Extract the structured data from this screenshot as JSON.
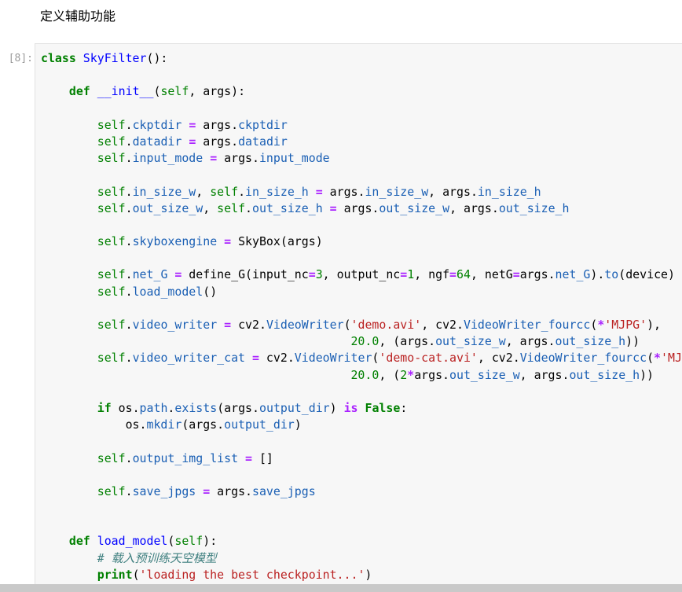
{
  "markdown": {
    "heading": "定义辅助功能"
  },
  "cell": {
    "prompt": "[8]:",
    "lines": [
      [
        {
          "t": "kw",
          "v": "class"
        },
        {
          "t": "",
          "v": " "
        },
        {
          "t": "cls",
          "v": "SkyFilter"
        },
        {
          "t": "",
          "v": "():"
        }
      ],
      [],
      [
        {
          "t": "",
          "v": "    "
        },
        {
          "t": "kw",
          "v": "def"
        },
        {
          "t": "",
          "v": " "
        },
        {
          "t": "fn",
          "v": "__init__"
        },
        {
          "t": "",
          "v": "("
        },
        {
          "t": "slf",
          "v": "self"
        },
        {
          "t": "",
          "v": ", args):"
        }
      ],
      [],
      [
        {
          "t": "",
          "v": "        "
        },
        {
          "t": "slf",
          "v": "self"
        },
        {
          "t": "",
          "v": "."
        },
        {
          "t": "attr",
          "v": "ckptdir"
        },
        {
          "t": "",
          "v": " "
        },
        {
          "t": "op",
          "v": "="
        },
        {
          "t": "",
          "v": " args."
        },
        {
          "t": "attr",
          "v": "ckptdir"
        }
      ],
      [
        {
          "t": "",
          "v": "        "
        },
        {
          "t": "slf",
          "v": "self"
        },
        {
          "t": "",
          "v": "."
        },
        {
          "t": "attr",
          "v": "datadir"
        },
        {
          "t": "",
          "v": " "
        },
        {
          "t": "op",
          "v": "="
        },
        {
          "t": "",
          "v": " args."
        },
        {
          "t": "attr",
          "v": "datadir"
        }
      ],
      [
        {
          "t": "",
          "v": "        "
        },
        {
          "t": "slf",
          "v": "self"
        },
        {
          "t": "",
          "v": "."
        },
        {
          "t": "attr",
          "v": "input_mode"
        },
        {
          "t": "",
          "v": " "
        },
        {
          "t": "op",
          "v": "="
        },
        {
          "t": "",
          "v": " args."
        },
        {
          "t": "attr",
          "v": "input_mode"
        }
      ],
      [],
      [
        {
          "t": "",
          "v": "        "
        },
        {
          "t": "slf",
          "v": "self"
        },
        {
          "t": "",
          "v": "."
        },
        {
          "t": "attr",
          "v": "in_size_w"
        },
        {
          "t": "",
          "v": ", "
        },
        {
          "t": "slf",
          "v": "self"
        },
        {
          "t": "",
          "v": "."
        },
        {
          "t": "attr",
          "v": "in_size_h"
        },
        {
          "t": "",
          "v": " "
        },
        {
          "t": "op",
          "v": "="
        },
        {
          "t": "",
          "v": " args."
        },
        {
          "t": "attr",
          "v": "in_size_w"
        },
        {
          "t": "",
          "v": ", args."
        },
        {
          "t": "attr",
          "v": "in_size_h"
        }
      ],
      [
        {
          "t": "",
          "v": "        "
        },
        {
          "t": "slf",
          "v": "self"
        },
        {
          "t": "",
          "v": "."
        },
        {
          "t": "attr",
          "v": "out_size_w"
        },
        {
          "t": "",
          "v": ", "
        },
        {
          "t": "slf",
          "v": "self"
        },
        {
          "t": "",
          "v": "."
        },
        {
          "t": "attr",
          "v": "out_size_h"
        },
        {
          "t": "",
          "v": " "
        },
        {
          "t": "op",
          "v": "="
        },
        {
          "t": "",
          "v": " args."
        },
        {
          "t": "attr",
          "v": "out_size_w"
        },
        {
          "t": "",
          "v": ", args."
        },
        {
          "t": "attr",
          "v": "out_size_h"
        }
      ],
      [],
      [
        {
          "t": "",
          "v": "        "
        },
        {
          "t": "slf",
          "v": "self"
        },
        {
          "t": "",
          "v": "."
        },
        {
          "t": "attr",
          "v": "skyboxengine"
        },
        {
          "t": "",
          "v": " "
        },
        {
          "t": "op",
          "v": "="
        },
        {
          "t": "",
          "v": " SkyBox(args)"
        }
      ],
      [],
      [
        {
          "t": "",
          "v": "        "
        },
        {
          "t": "slf",
          "v": "self"
        },
        {
          "t": "",
          "v": "."
        },
        {
          "t": "attr",
          "v": "net_G"
        },
        {
          "t": "",
          "v": " "
        },
        {
          "t": "op",
          "v": "="
        },
        {
          "t": "",
          "v": " define_G(input_nc"
        },
        {
          "t": "op",
          "v": "="
        },
        {
          "t": "num",
          "v": "3"
        },
        {
          "t": "",
          "v": ", output_nc"
        },
        {
          "t": "op",
          "v": "="
        },
        {
          "t": "num",
          "v": "1"
        },
        {
          "t": "",
          "v": ", ngf"
        },
        {
          "t": "op",
          "v": "="
        },
        {
          "t": "num",
          "v": "64"
        },
        {
          "t": "",
          "v": ", netG"
        },
        {
          "t": "op",
          "v": "="
        },
        {
          "t": "",
          "v": "args."
        },
        {
          "t": "attr",
          "v": "net_G"
        },
        {
          "t": "",
          "v": ")."
        },
        {
          "t": "attr",
          "v": "to"
        },
        {
          "t": "",
          "v": "(device)"
        }
      ],
      [
        {
          "t": "",
          "v": "        "
        },
        {
          "t": "slf",
          "v": "self"
        },
        {
          "t": "",
          "v": "."
        },
        {
          "t": "attr",
          "v": "load_model"
        },
        {
          "t": "",
          "v": "()"
        }
      ],
      [],
      [
        {
          "t": "",
          "v": "        "
        },
        {
          "t": "slf",
          "v": "self"
        },
        {
          "t": "",
          "v": "."
        },
        {
          "t": "attr",
          "v": "video_writer"
        },
        {
          "t": "",
          "v": " "
        },
        {
          "t": "op",
          "v": "="
        },
        {
          "t": "",
          "v": " cv2."
        },
        {
          "t": "attr",
          "v": "VideoWriter"
        },
        {
          "t": "",
          "v": "("
        },
        {
          "t": "str",
          "v": "'demo.avi'"
        },
        {
          "t": "",
          "v": ", cv2."
        },
        {
          "t": "attr",
          "v": "VideoWriter_fourcc"
        },
        {
          "t": "",
          "v": "("
        },
        {
          "t": "op",
          "v": "*"
        },
        {
          "t": "str",
          "v": "'MJPG'"
        },
        {
          "t": "",
          "v": "),"
        }
      ],
      [
        {
          "t": "",
          "v": "                                            "
        },
        {
          "t": "num",
          "v": "20.0"
        },
        {
          "t": "",
          "v": ", (args."
        },
        {
          "t": "attr",
          "v": "out_size_w"
        },
        {
          "t": "",
          "v": ", args."
        },
        {
          "t": "attr",
          "v": "out_size_h"
        },
        {
          "t": "",
          "v": "))"
        }
      ],
      [
        {
          "t": "",
          "v": "        "
        },
        {
          "t": "slf",
          "v": "self"
        },
        {
          "t": "",
          "v": "."
        },
        {
          "t": "attr",
          "v": "video_writer_cat"
        },
        {
          "t": "",
          "v": " "
        },
        {
          "t": "op",
          "v": "="
        },
        {
          "t": "",
          "v": " cv2."
        },
        {
          "t": "attr",
          "v": "VideoWriter"
        },
        {
          "t": "",
          "v": "("
        },
        {
          "t": "str",
          "v": "'demo-cat.avi'"
        },
        {
          "t": "",
          "v": ", cv2."
        },
        {
          "t": "attr",
          "v": "VideoWriter_fourcc"
        },
        {
          "t": "",
          "v": "("
        },
        {
          "t": "op",
          "v": "*"
        },
        {
          "t": "str",
          "v": "'MJ"
        }
      ],
      [
        {
          "t": "",
          "v": "                                            "
        },
        {
          "t": "num",
          "v": "20.0"
        },
        {
          "t": "",
          "v": ", ("
        },
        {
          "t": "num",
          "v": "2"
        },
        {
          "t": "op",
          "v": "*"
        },
        {
          "t": "",
          "v": "args."
        },
        {
          "t": "attr",
          "v": "out_size_w"
        },
        {
          "t": "",
          "v": ", args."
        },
        {
          "t": "attr",
          "v": "out_size_h"
        },
        {
          "t": "",
          "v": "))"
        }
      ],
      [],
      [
        {
          "t": "",
          "v": "        "
        },
        {
          "t": "kw",
          "v": "if"
        },
        {
          "t": "",
          "v": " os."
        },
        {
          "t": "attr",
          "v": "path"
        },
        {
          "t": "",
          "v": "."
        },
        {
          "t": "attr",
          "v": "exists"
        },
        {
          "t": "",
          "v": "(args."
        },
        {
          "t": "attr",
          "v": "output_dir"
        },
        {
          "t": "",
          "v": ") "
        },
        {
          "t": "ow",
          "v": "is"
        },
        {
          "t": "",
          "v": " "
        },
        {
          "t": "kw",
          "v": "False"
        },
        {
          "t": "",
          "v": ":"
        }
      ],
      [
        {
          "t": "",
          "v": "            os."
        },
        {
          "t": "attr",
          "v": "mkdir"
        },
        {
          "t": "",
          "v": "(args."
        },
        {
          "t": "attr",
          "v": "output_dir"
        },
        {
          "t": "",
          "v": ")"
        }
      ],
      [],
      [
        {
          "t": "",
          "v": "        "
        },
        {
          "t": "slf",
          "v": "self"
        },
        {
          "t": "",
          "v": "."
        },
        {
          "t": "attr",
          "v": "output_img_list"
        },
        {
          "t": "",
          "v": " "
        },
        {
          "t": "op",
          "v": "="
        },
        {
          "t": "",
          "v": " []"
        }
      ],
      [],
      [
        {
          "t": "",
          "v": "        "
        },
        {
          "t": "slf",
          "v": "self"
        },
        {
          "t": "",
          "v": "."
        },
        {
          "t": "attr",
          "v": "save_jpgs"
        },
        {
          "t": "",
          "v": " "
        },
        {
          "t": "op",
          "v": "="
        },
        {
          "t": "",
          "v": " args."
        },
        {
          "t": "attr",
          "v": "save_jpgs"
        }
      ],
      [],
      [],
      [
        {
          "t": "",
          "v": "    "
        },
        {
          "t": "kw",
          "v": "def"
        },
        {
          "t": "",
          "v": " "
        },
        {
          "t": "fn",
          "v": "load_model"
        },
        {
          "t": "",
          "v": "("
        },
        {
          "t": "slf",
          "v": "self"
        },
        {
          "t": "",
          "v": "):"
        }
      ],
      [
        {
          "t": "",
          "v": "        "
        },
        {
          "t": "cmt",
          "v": "# 载入预训练天空模型"
        }
      ],
      [
        {
          "t": "",
          "v": "        "
        },
        {
          "t": "kw",
          "v": "print"
        },
        {
          "t": "",
          "v": "("
        },
        {
          "t": "str",
          "v": "'loading the best checkpoint...'"
        },
        {
          "t": "",
          "v": ")"
        }
      ]
    ]
  }
}
